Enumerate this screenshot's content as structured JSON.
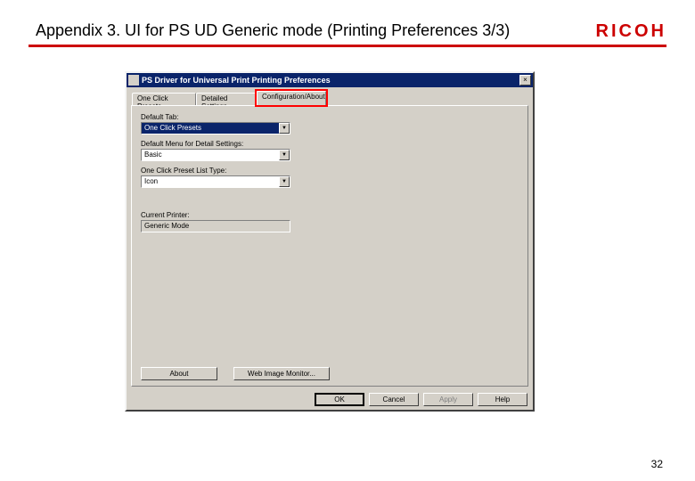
{
  "slide": {
    "title": "Appendix 3. UI for PS UD Generic mode (Printing Preferences 3/3)",
    "logo": "RICOH",
    "page_number": "32"
  },
  "dialog": {
    "title": "PS Driver for Universal Print Printing Preferences",
    "close_glyph": "×",
    "tabs": {
      "t1": "One Click Presets",
      "t2": "Detailed Settings",
      "t3": "Configuration/About"
    },
    "fields": {
      "default_tab_label": "Default Tab:",
      "default_tab_value": "One Click Presets",
      "default_menu_label": "Default Menu for Detail Settings:",
      "default_menu_value": "Basic",
      "preset_list_label": "One Click Preset List Type:",
      "preset_list_value": "Icon",
      "current_printer_label": "Current Printer:",
      "current_printer_value": "Generic Mode"
    },
    "dropdown_arrow": "▼",
    "buttons": {
      "about": "About",
      "web_image_monitor": "Web Image Monitor...",
      "ok": "OK",
      "cancel": "Cancel",
      "apply": "Apply",
      "help": "Help"
    }
  }
}
